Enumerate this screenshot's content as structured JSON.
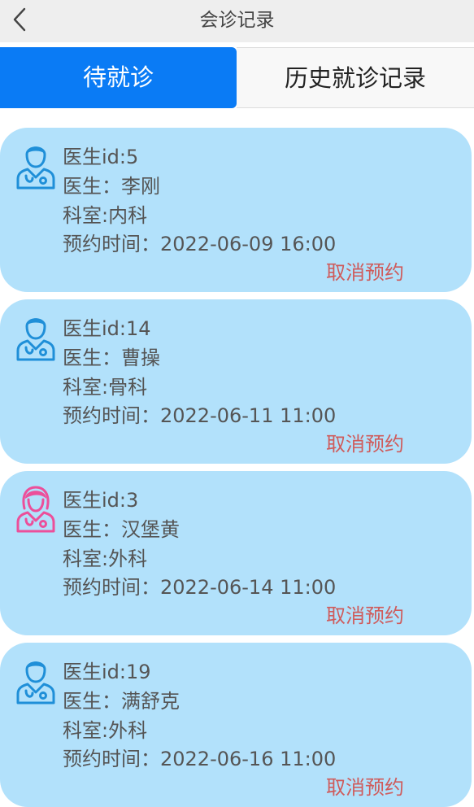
{
  "nav": {
    "title": "会诊记录",
    "back_icon": "chevron-left-icon"
  },
  "tabs": [
    {
      "label": "待就诊",
      "active": true
    },
    {
      "label": "历史就诊记录",
      "active": false
    }
  ],
  "colors": {
    "tab_active_bg": "#0a7bf5",
    "card_bg": "#b2e1fb",
    "cancel_text": "#cf5b5b",
    "male_doctor_icon": "#1f8fd8",
    "female_doctor_icon": "#ec4f9a"
  },
  "appointments": [
    {
      "doctor_id": "医生id:5",
      "doctor_name": "医生：李刚",
      "department": "科室:内科",
      "time": "预约时间：2022-06-09 16:00",
      "cancel_label": "取消预约",
      "icon": "male-doctor-icon"
    },
    {
      "doctor_id": "医生id:14",
      "doctor_name": "医生：曹操",
      "department": "科室:骨科",
      "time": "预约时间：2022-06-11 11:00",
      "cancel_label": "取消预约",
      "icon": "male-doctor-icon"
    },
    {
      "doctor_id": "医生id:3",
      "doctor_name": "医生：汉堡黄",
      "department": "科室:外科",
      "time": "预约时间：2022-06-14 11:00",
      "cancel_label": "取消预约",
      "icon": "female-doctor-icon"
    },
    {
      "doctor_id": "医生id:19",
      "doctor_name": "医生：满舒克",
      "department": "科室:外科",
      "time": "预约时间：2022-06-16 11:00",
      "cancel_label": "取消预约",
      "icon": "male-doctor-icon"
    }
  ]
}
